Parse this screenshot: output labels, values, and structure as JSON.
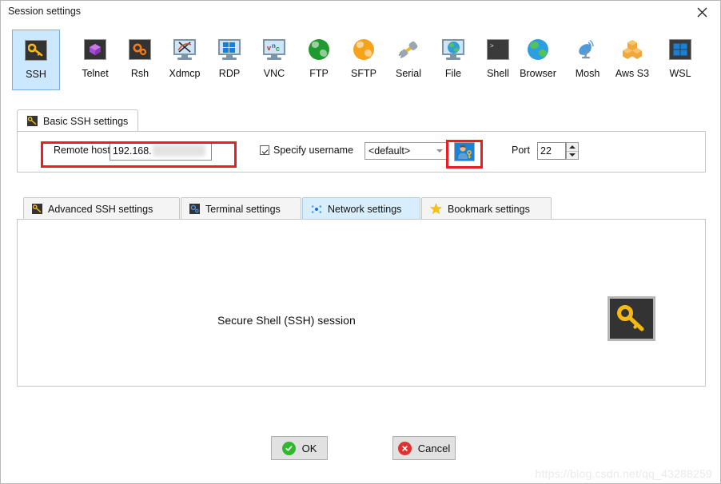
{
  "window": {
    "title": "Session settings",
    "close_label": "×",
    "close_icon": "close-icon"
  },
  "protocols": [
    {
      "id": "ssh",
      "label": "SSH",
      "icon": "key-icon",
      "selected": true
    },
    {
      "id": "telnet",
      "label": "Telnet",
      "icon": "purple-cube-icon",
      "selected": false
    },
    {
      "id": "rsh",
      "label": "Rsh",
      "icon": "orange-gears-icon",
      "selected": false
    },
    {
      "id": "xdmcp",
      "label": "Xdmcp",
      "icon": "x-monitor-icon",
      "selected": false
    },
    {
      "id": "rdp",
      "label": "RDP",
      "icon": "windows-monitor-icon",
      "selected": false
    },
    {
      "id": "vnc",
      "label": "VNC",
      "icon": "vnc-monitor-icon",
      "selected": false
    },
    {
      "id": "ftp",
      "label": "FTP",
      "icon": "green-globe-icon",
      "selected": false
    },
    {
      "id": "sftp",
      "label": "SFTP",
      "icon": "orange-globe-icon",
      "selected": false
    },
    {
      "id": "serial",
      "label": "Serial",
      "icon": "serial-plug-icon",
      "selected": false
    },
    {
      "id": "file",
      "label": "File",
      "icon": "globe-monitor-icon",
      "selected": false
    },
    {
      "id": "shell",
      "label": "Shell",
      "icon": "terminal-prompt-icon",
      "selected": false
    },
    {
      "id": "browser",
      "label": "Browser",
      "icon": "blue-globe-icon",
      "selected": false
    },
    {
      "id": "mosh",
      "label": "Mosh",
      "icon": "satellite-dish-icon",
      "selected": false
    },
    {
      "id": "aws",
      "label": "Aws S3",
      "icon": "aws-cubes-icon",
      "selected": false
    },
    {
      "id": "wsl",
      "label": "WSL",
      "icon": "windows-logo-icon",
      "selected": false
    }
  ],
  "basic_tab": {
    "label": "Basic SSH settings",
    "icon": "key-icon"
  },
  "basic_form": {
    "remote_host_label": "Remote host *",
    "remote_host_value": "192.168.",
    "remote_host_redacted": true,
    "specify_username_label": "Specify username",
    "specify_username_checked": true,
    "username_value": "<default>",
    "user_button_icon": "user-key-icon",
    "port_label": "Port",
    "port_value": "22",
    "spinner_up_icon": "chevron-up-icon",
    "spinner_down_icon": "chevron-down-icon"
  },
  "sub_tabs": [
    {
      "id": "advanced",
      "label": "Advanced SSH settings",
      "icon": "key-icon",
      "active": false
    },
    {
      "id": "terminal",
      "label": "Terminal settings",
      "icon": "gear-icon",
      "active": false
    },
    {
      "id": "network",
      "label": "Network settings",
      "icon": "network-dots-icon",
      "active": true
    },
    {
      "id": "bookmark",
      "label": "Bookmark settings",
      "icon": "star-icon",
      "active": false
    }
  ],
  "panel": {
    "caption": "Secure Shell (SSH) session",
    "big_icon": "key-icon"
  },
  "buttons": {
    "ok_label": "OK",
    "ok_icon": "check-circle-icon",
    "cancel_label": "Cancel",
    "cancel_icon": "x-circle-icon"
  },
  "watermark": "https://blog.csdn.net/qq_43288259",
  "colors": {
    "selection_blue": "#cce8ff",
    "highlight_red": "#ee1c22",
    "ok_green": "#2eb82e",
    "cancel_red": "#e03030",
    "accent_blue": "#1a82d8"
  }
}
